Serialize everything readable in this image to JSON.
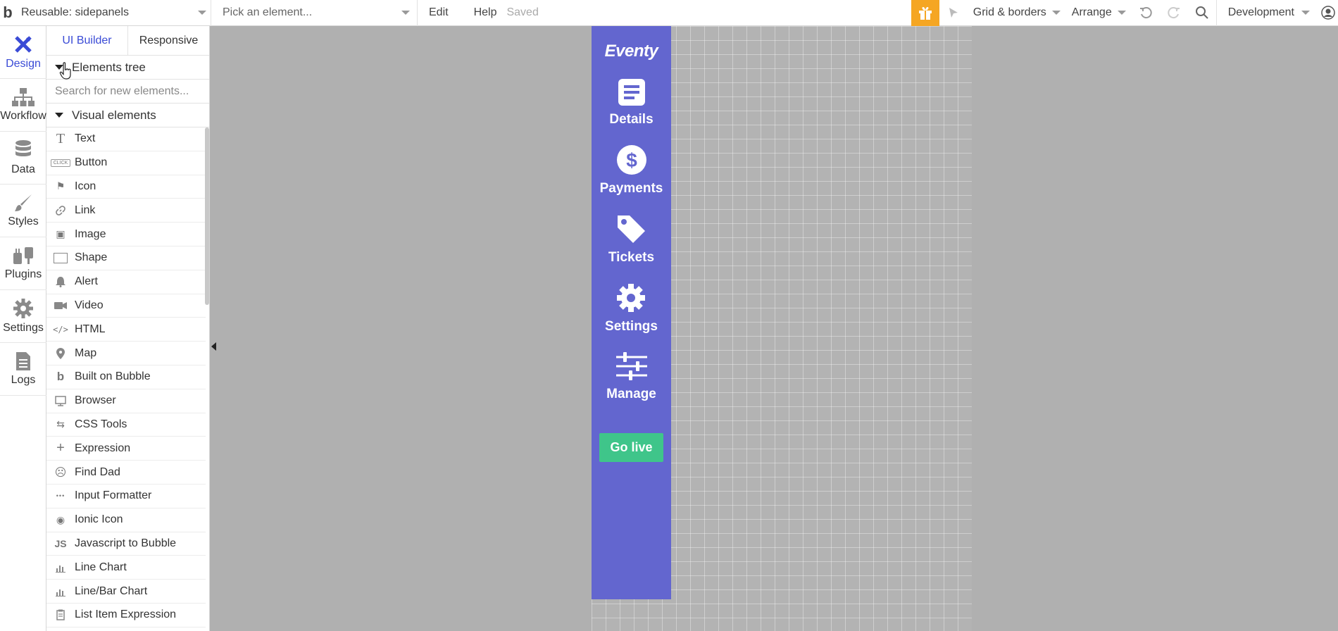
{
  "topbar": {
    "logo": "b",
    "page_select": "Reusable: sidepanels",
    "element_select_placeholder": "Pick an element...",
    "menu": {
      "edit": "Edit",
      "help": "Help"
    },
    "status": "Saved",
    "grid_borders": "Grid & borders",
    "arrange": "Arrange",
    "environment": "Development"
  },
  "rail": {
    "items": [
      {
        "label": "Design",
        "icon": "design-icon",
        "active": true
      },
      {
        "label": "Workflow",
        "icon": "workflow-icon"
      },
      {
        "label": "Data",
        "icon": "database-icon"
      },
      {
        "label": "Styles",
        "icon": "brush-icon"
      },
      {
        "label": "Plugins",
        "icon": "plug-icon"
      },
      {
        "label": "Settings",
        "icon": "gear-icon"
      },
      {
        "label": "Logs",
        "icon": "document-icon"
      }
    ]
  },
  "palette": {
    "tabs": [
      "UI Builder",
      "Responsive"
    ],
    "elements_tree": "Elements tree",
    "search_placeholder": "Search for new elements...",
    "section": "Visual elements",
    "items": [
      {
        "label": "Text",
        "icon": "T"
      },
      {
        "label": "Button",
        "icon": "CLICK"
      },
      {
        "label": "Icon",
        "icon": "⚑"
      },
      {
        "label": "Link",
        "icon": "🔗"
      },
      {
        "label": "Image",
        "icon": "▣"
      },
      {
        "label": "Shape",
        "icon": "▭"
      },
      {
        "label": "Alert",
        "icon": "🔔"
      },
      {
        "label": "Video",
        "icon": "▶"
      },
      {
        "label": "HTML",
        "icon": "</>"
      },
      {
        "label": "Map",
        "icon": "●"
      },
      {
        "label": "Built on Bubble",
        "icon": "b"
      },
      {
        "label": "Browser",
        "icon": "▭"
      },
      {
        "label": "CSS Tools",
        "icon": "⇆"
      },
      {
        "label": "Expression",
        "icon": "+"
      },
      {
        "label": "Find Dad",
        "icon": "☹"
      },
      {
        "label": "Input Formatter",
        "icon": "•••"
      },
      {
        "label": "Ionic Icon",
        "icon": "◉"
      },
      {
        "label": "Javascript to Bubble",
        "icon": "JS"
      },
      {
        "label": "Line Chart",
        "icon": "▮"
      },
      {
        "label": "Line/Bar Chart",
        "icon": "▮"
      },
      {
        "label": "List Item Expression",
        "icon": "▤"
      }
    ]
  },
  "sidepanel": {
    "logo": "Eventy",
    "bg": "#6366cf",
    "items": [
      {
        "label": "Details",
        "icon": "list-document-icon"
      },
      {
        "label": "Payments",
        "icon": "dollar-circle-icon"
      },
      {
        "label": "Tickets",
        "icon": "tag-icon"
      },
      {
        "label": "Settings",
        "icon": "gear-icon"
      },
      {
        "label": "Manage",
        "icon": "sliders-icon"
      }
    ],
    "cta": "Go live",
    "cta_color": "#3fc58a"
  }
}
